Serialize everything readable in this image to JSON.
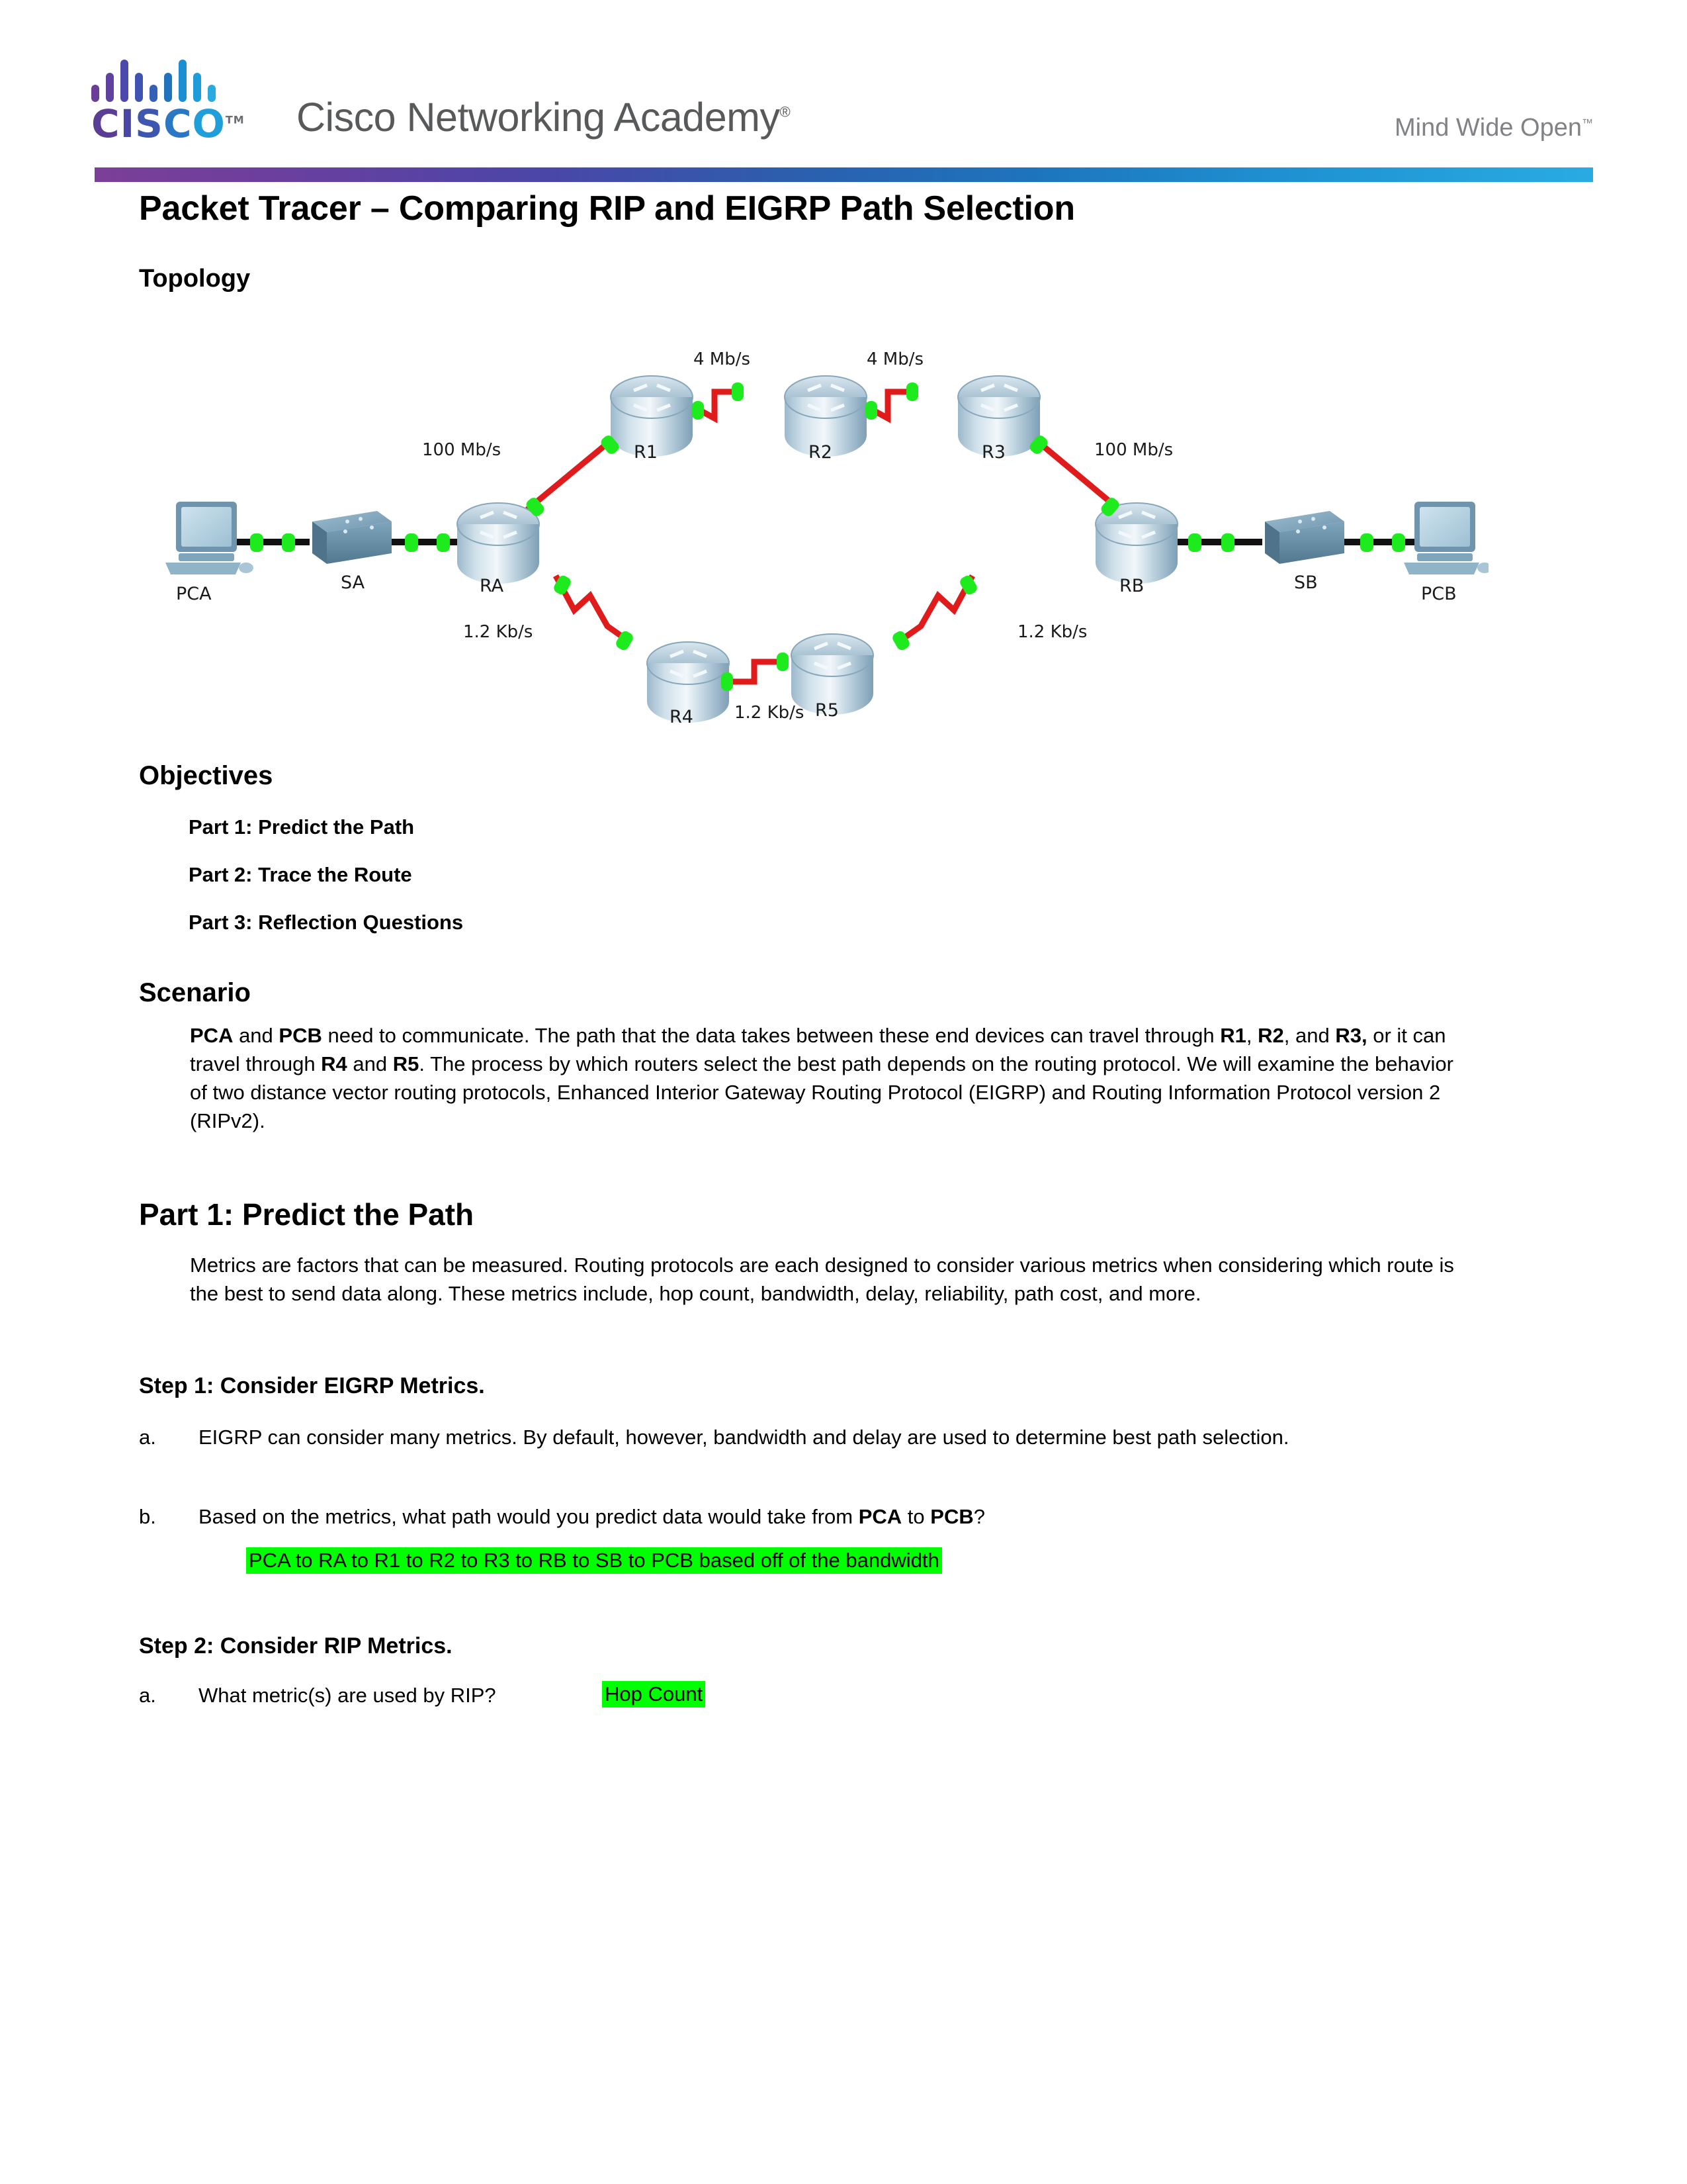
{
  "header": {
    "brand_wordmark": "CISCO",
    "brand_tm": "TM",
    "academy_title": "Cisco Networking Academy",
    "academy_reg": "®",
    "tagline": "Mind Wide Open",
    "tagline_tm": "™",
    "logo_colors": [
      "#6b3f98",
      "#5b46a3",
      "#4550ae",
      "#2f6bb8",
      "#1f86cc",
      "#1d9ad6",
      "#29abe2"
    ],
    "rule_gradient_start": "#7b3f98",
    "rule_gradient_end": "#29abe2"
  },
  "document": {
    "title": "Packet Tracer – Comparing RIP and EIGRP Path Selection",
    "topology_heading": "Topology",
    "objectives_heading": "Objectives",
    "objectives": [
      "Part 1: Predict the Path",
      "Part 2: Trace the Route",
      "Part 3: Reflection Questions"
    ],
    "scenario_heading": "Scenario",
    "scenario_paragraph": "PCA and PCB need to communicate. The path that the data takes between these end devices can travel through R1, R2, and R3, or it can travel through R4 and R5. The process by which routers select the best path depends on the routing protocol. We will examine the behavior of two distance vector routing protocols, Enhanced Interior Gateway Routing Protocol (EIGRP) and Routing Information Protocol version 2 (RIPv2).",
    "part1_heading": "Part 1: Predict the Path",
    "part1_paragraph": "Metrics are factors that can be measured. Routing protocols are each designed to consider various metrics when considering which route is the best to send data along. These metrics include, hop count, bandwidth, delay, reliability, path cost, and more.",
    "step1_heading": "Step 1: Consider EIGRP Metrics.",
    "step1_items": [
      {
        "letter": "a.",
        "text": "EIGRP can consider many metrics. By default, however, bandwidth and delay are used to determine best path selection."
      },
      {
        "letter": "b.",
        "text": "Based on the metrics, what path would you predict data would take from PCA to PCB?"
      }
    ],
    "step1_answer": "PCA to RA to R1 to R2 to R3 to RB to SB to PCB  based off of the bandwidth",
    "step2_heading": "Step 2: Consider RIP Metrics.",
    "step2_item_letter": "a.",
    "step2_item_text": "What metric(s) are used by RIP?",
    "step2_answer": "Hop Count",
    "highlight_color": "#00ff00"
  },
  "topology": {
    "nodes": [
      {
        "id": "PCA",
        "label": "PCA",
        "type": "pc"
      },
      {
        "id": "SA",
        "label": "SA",
        "type": "switch"
      },
      {
        "id": "RA",
        "label": "RA",
        "type": "router"
      },
      {
        "id": "R1",
        "label": "R1",
        "type": "router"
      },
      {
        "id": "R2",
        "label": "R2",
        "type": "router"
      },
      {
        "id": "R3",
        "label": "R3",
        "type": "router"
      },
      {
        "id": "R4",
        "label": "R4",
        "type": "router"
      },
      {
        "id": "R5",
        "label": "R5",
        "type": "router"
      },
      {
        "id": "RB",
        "label": "RB",
        "type": "router"
      },
      {
        "id": "SB",
        "label": "SB",
        "type": "switch"
      },
      {
        "id": "PCB",
        "label": "PCB",
        "type": "pc"
      }
    ],
    "links": [
      {
        "from": "PCA",
        "to": "SA",
        "label": "",
        "media": "ethernet"
      },
      {
        "from": "SA",
        "to": "RA",
        "label": "",
        "media": "ethernet"
      },
      {
        "from": "RA",
        "to": "R1",
        "label": "100 Mb/s",
        "media": "serial"
      },
      {
        "from": "R1",
        "to": "R2",
        "label": "4 Mb/s",
        "media": "serial"
      },
      {
        "from": "R2",
        "to": "R3",
        "label": "4 Mb/s",
        "media": "serial"
      },
      {
        "from": "R3",
        "to": "RB",
        "label": "100 Mb/s",
        "media": "serial"
      },
      {
        "from": "RA",
        "to": "R4",
        "label": "1.2 Kb/s",
        "media": "serial"
      },
      {
        "from": "R4",
        "to": "R5",
        "label": "1.2 Kb/s",
        "media": "serial"
      },
      {
        "from": "R5",
        "to": "RB",
        "label": "1.2 Kb/s",
        "media": "serial"
      },
      {
        "from": "RB",
        "to": "SB",
        "label": "",
        "media": "ethernet"
      },
      {
        "from": "SB",
        "to": "PCB",
        "label": "",
        "media": "ethernet"
      }
    ],
    "link_labels": {
      "ra_r1": "100 Mb/s",
      "r1_r2": "4 Mb/s",
      "r2_r3": "4 Mb/s",
      "r3_rb": "100 Mb/s",
      "ra_r4": "1.2 Kb/s",
      "r4_r5": "1.2 Kb/s",
      "r5_rb": "1.2 Kb/s"
    },
    "node_labels": {
      "pca": "PCA",
      "sa": "SA",
      "ra": "RA",
      "r1": "R1",
      "r2": "R2",
      "r3": "R3",
      "r4": "R4",
      "r5": "R5",
      "rb": "RB",
      "sb": "SB",
      "pcb": "PCB"
    },
    "serial_link_color": "#e01b1b",
    "ethernet_link_color": "#111111",
    "status_dot_color": "#1eeb1e"
  }
}
